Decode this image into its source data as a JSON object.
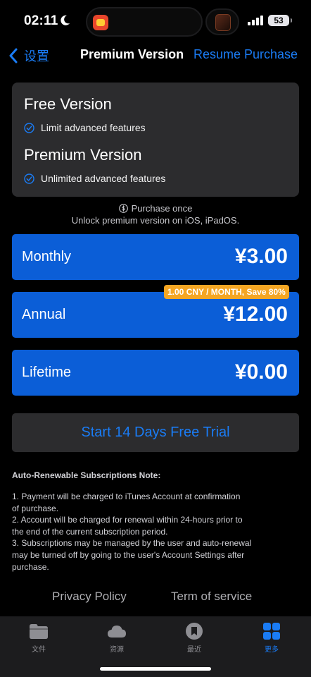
{
  "status_bar": {
    "time": "02:11",
    "battery": "53"
  },
  "nav": {
    "back_label": "设置",
    "title": "Premium Version",
    "resume_label": "Resume Purchase"
  },
  "compare": {
    "free_title": "Free Version",
    "free_feature": "Limit advanced features",
    "premium_title": "Premium Version",
    "premium_feature": "Unlimited advanced features"
  },
  "purchase": {
    "once_label": "Purchase once",
    "unlock_label": "Unlock premium version on iOS, iPadOS."
  },
  "plans": [
    {
      "name": "Monthly",
      "price": "¥3.00"
    },
    {
      "name": "Annual",
      "price": "¥12.00",
      "badge": "1.00 CNY / MONTH, Save 80%"
    },
    {
      "name": "Lifetime",
      "price": "¥0.00"
    }
  ],
  "trial_label": "Start 14 Days Free Trial",
  "notes": {
    "title": "Auto-Renewable Subscriptions Note:",
    "items": [
      "1. Payment will be charged to iTunes Account at confirmation\nof purchase.",
      "2. Account will be charged for renewal within 24-hours prior to\nthe end of the current subscription period.",
      "3. Subscriptions may be managed by the user and auto-renewal\nmay be turned off by going to the user's Account Settings after\npurchase."
    ]
  },
  "footer": {
    "privacy_label": "Privacy Policy",
    "terms_label": "Term of service"
  },
  "tabs": [
    {
      "label": "文件",
      "icon": "folder-icon"
    },
    {
      "label": "资源",
      "icon": "cloud-icon"
    },
    {
      "label": "最近",
      "icon": "bookmark-icon"
    },
    {
      "label": "更多",
      "icon": "grid-icon",
      "active": true
    }
  ],
  "colors": {
    "accent": "#1a7cf5",
    "plan_button": "#0b5ed7",
    "badge": "#f5a623",
    "card": "#2c2c2e",
    "background": "#000000"
  }
}
